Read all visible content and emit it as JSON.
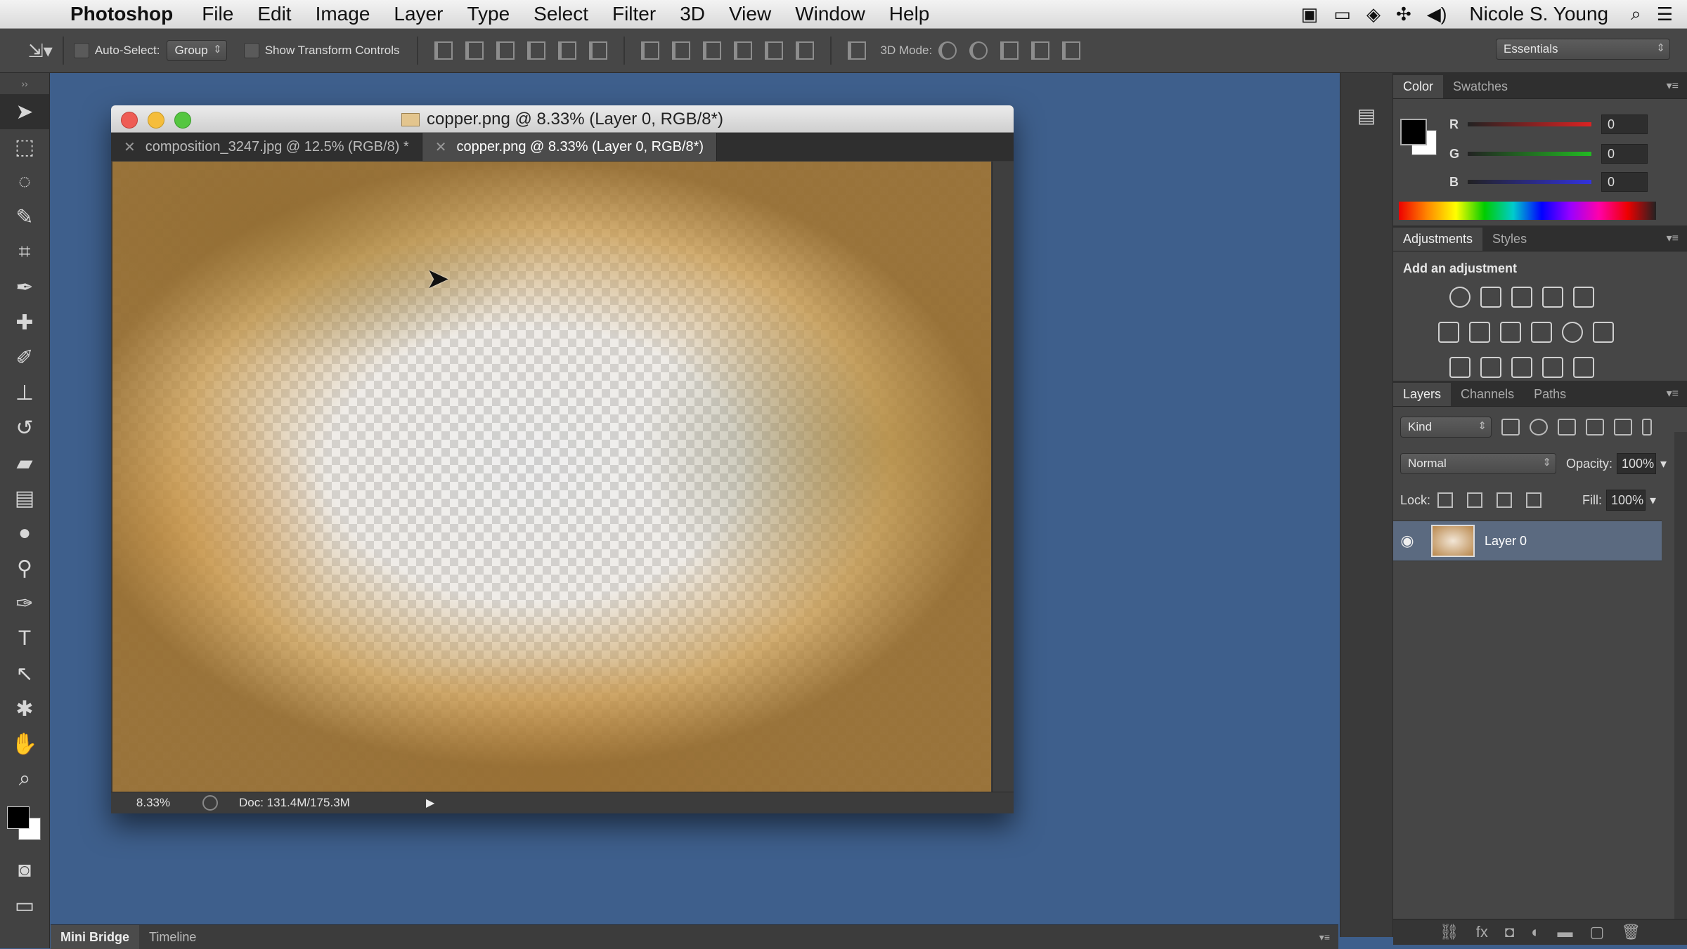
{
  "menubar": {
    "app_name": "Photoshop",
    "items": [
      "File",
      "Edit",
      "Image",
      "Layer",
      "Type",
      "Select",
      "Filter",
      "3D",
      "View",
      "Window",
      "Help"
    ],
    "user": "Nicole S. Young",
    "status_icons": [
      "video-icon",
      "display-icon",
      "dropbox-icon",
      "bluetooth-icon",
      "volume-icon",
      "search-icon",
      "list-icon"
    ]
  },
  "options": {
    "auto_select_label": "Auto-Select:",
    "auto_select_value": "Group",
    "show_transform_label": "Show Transform Controls",
    "mode_3d_label": "3D Mode:",
    "workspace": "Essentials"
  },
  "document": {
    "window_title": "copper.png @ 8.33% (Layer 0, RGB/8*)",
    "tabs": [
      {
        "label": "composition_3247.jpg @ 12.5% (RGB/8) *",
        "active": false
      },
      {
        "label": "copper.png @ 8.33% (Layer 0, RGB/8*)",
        "active": true
      }
    ],
    "zoom": "8.33%",
    "doc_size": "Doc: 131.4M/175.3M"
  },
  "color_panel": {
    "tabs": [
      "Color",
      "Swatches"
    ],
    "channels": [
      {
        "label": "R",
        "value": "0",
        "color": "#d22"
      },
      {
        "label": "G",
        "value": "0",
        "color": "#2b2"
      },
      {
        "label": "B",
        "value": "0",
        "color": "#33d"
      }
    ]
  },
  "adjustments_panel": {
    "tabs": [
      "Adjustments",
      "Styles"
    ],
    "title": "Add an adjustment"
  },
  "layers_panel": {
    "tabs": [
      "Layers",
      "Channels",
      "Paths"
    ],
    "filter_kind": "Kind",
    "blend_mode": "Normal",
    "opacity_label": "Opacity:",
    "opacity_value": "100%",
    "lock_label": "Lock:",
    "fill_label": "Fill:",
    "fill_value": "100%",
    "layers": [
      {
        "name": "Layer 0",
        "visible": true
      }
    ]
  },
  "dock": {
    "tabs": [
      "Mini Bridge",
      "Timeline"
    ]
  }
}
